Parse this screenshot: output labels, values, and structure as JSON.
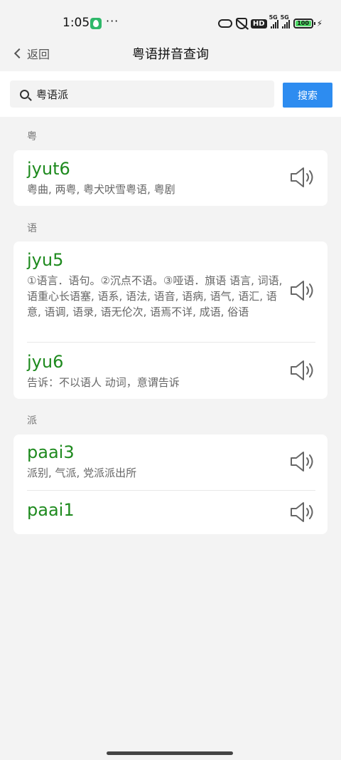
{
  "status_bar": {
    "time": "1:05",
    "dots": "···",
    "hd": "HD",
    "signal1_label": "5G",
    "signal2_label": "5G",
    "battery": "100"
  },
  "nav": {
    "back_label": "返回",
    "title": "粤语拼音查询"
  },
  "search": {
    "value": "粤语派",
    "button_label": "搜索"
  },
  "groups": [
    {
      "char": "粤",
      "entries": [
        {
          "jyutping": "jyut6",
          "definition": "粤曲, 两粤, 粤犬吠雪粤语, 粤剧"
        }
      ]
    },
    {
      "char": "语",
      "entries": [
        {
          "jyutping": "jyu5",
          "definition": "①语言．语句。②沉点不语。③哑语．旗语 语言, 词语, 语重心长语塞, 语系, 语法, 语音, 语病, 语气, 语汇, 语意, 语调, 语录, 语无伦次, 语焉不详, 成语, 俗语"
        },
        {
          "jyutping": "jyu6",
          "definition": "告诉：不以语人 动词，意谓告诉"
        }
      ]
    },
    {
      "char": "派",
      "entries": [
        {
          "jyutping": "paai3",
          "definition": "派别, 气派, 党派派出所"
        },
        {
          "jyutping": "paai1",
          "definition": ""
        }
      ]
    }
  ],
  "colors": {
    "jyutping": "#1e8a1e",
    "search_button": "#2d8cf0"
  }
}
